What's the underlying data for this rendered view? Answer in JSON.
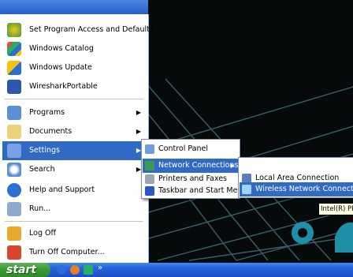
{
  "start_menu": {
    "pinned": [
      {
        "label": "Set Program Access and Defaults",
        "icon": "program-access-icon"
      },
      {
        "label": "Windows Catalog",
        "icon": "windows-catalog-icon"
      },
      {
        "label": "Windows Update",
        "icon": "windows-update-icon"
      },
      {
        "label": "WiresharkPortable",
        "icon": "wireshark-icon"
      }
    ],
    "items": [
      {
        "label": "Programs",
        "icon": "programs-icon"
      },
      {
        "label": "Documents",
        "icon": "documents-icon"
      },
      {
        "label": "Settings",
        "icon": "settings-icon"
      },
      {
        "label": "Search",
        "icon": "search-icon"
      },
      {
        "label": "Help and Support",
        "icon": "help-icon"
      },
      {
        "label": "Run...",
        "icon": "run-icon"
      },
      {
        "label": "Log Off",
        "icon": "log-off-icon"
      },
      {
        "label": "Turn Off Computer...",
        "icon": "power-icon"
      }
    ]
  },
  "settings_submenu": {
    "items": [
      {
        "label": "Control Panel",
        "icon": "control-panel-icon"
      },
      {
        "label": "Network Connections",
        "icon": "network-connections-icon"
      },
      {
        "label": "Printers and Faxes",
        "icon": "printer-icon"
      },
      {
        "label": "Taskbar and Start Menu",
        "icon": "taskbar-icon"
      }
    ]
  },
  "network_submenu": {
    "items": [
      {
        "label": "Local Area Connection",
        "icon": "local-area-connection-icon"
      },
      {
        "label": "Wireless Network Connection",
        "icon": "wireless-connection-icon"
      }
    ]
  },
  "tooltip": {
    "text": "Intel(R) PR"
  },
  "taskbar": {
    "start_label": "start",
    "overflow_label": "»"
  },
  "colors": {
    "selection": "#316ac5",
    "taskbar": "#2058d2",
    "start_button": "#3a9a36",
    "menu_frame": "#2a52c8"
  }
}
